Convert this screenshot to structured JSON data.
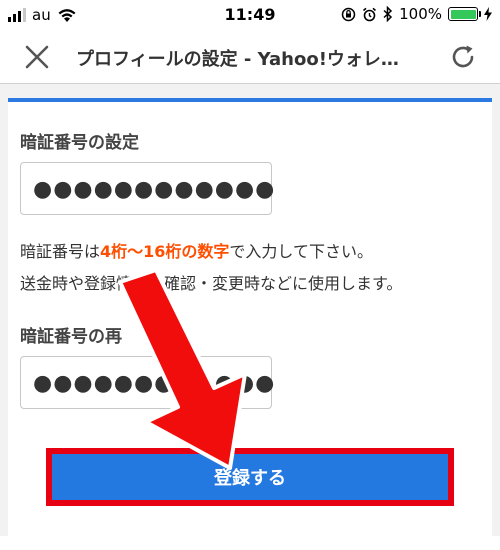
{
  "status_bar": {
    "carrier": "au",
    "time": "11:49",
    "battery_percent": "100%",
    "battery_level": 1.0,
    "icons": [
      "signal-icon",
      "wifi-icon",
      "orientation-lock-icon",
      "alarm-icon",
      "bluetooth-icon",
      "battery-icon",
      "charging-icon"
    ]
  },
  "nav": {
    "title": "プロフィールの設定 - Yahoo!ウォレ…",
    "close_icon": "close-icon",
    "reload_icon": "reload-icon"
  },
  "form": {
    "pin_label": "暗証番号の設定",
    "pin_value": "●●●●●●●●●●●●",
    "hint_prefix": "暗証番号は",
    "hint_strong": "4桁〜16桁の数字",
    "hint_suffix": "で入力して下さい。",
    "hint_line2": "送金時や登録情報の確認・変更時などに使用します。",
    "pin_confirm_label": "暗証番号の再",
    "pin_confirm_value": "●●●●●●●●●●●●"
  },
  "actions": {
    "register_label": "登録する"
  },
  "colors": {
    "accent_blue": "#2479e0",
    "highlight_red": "#e60012",
    "hint_orange": "#ff4e00",
    "battery_green": "#34c759"
  }
}
